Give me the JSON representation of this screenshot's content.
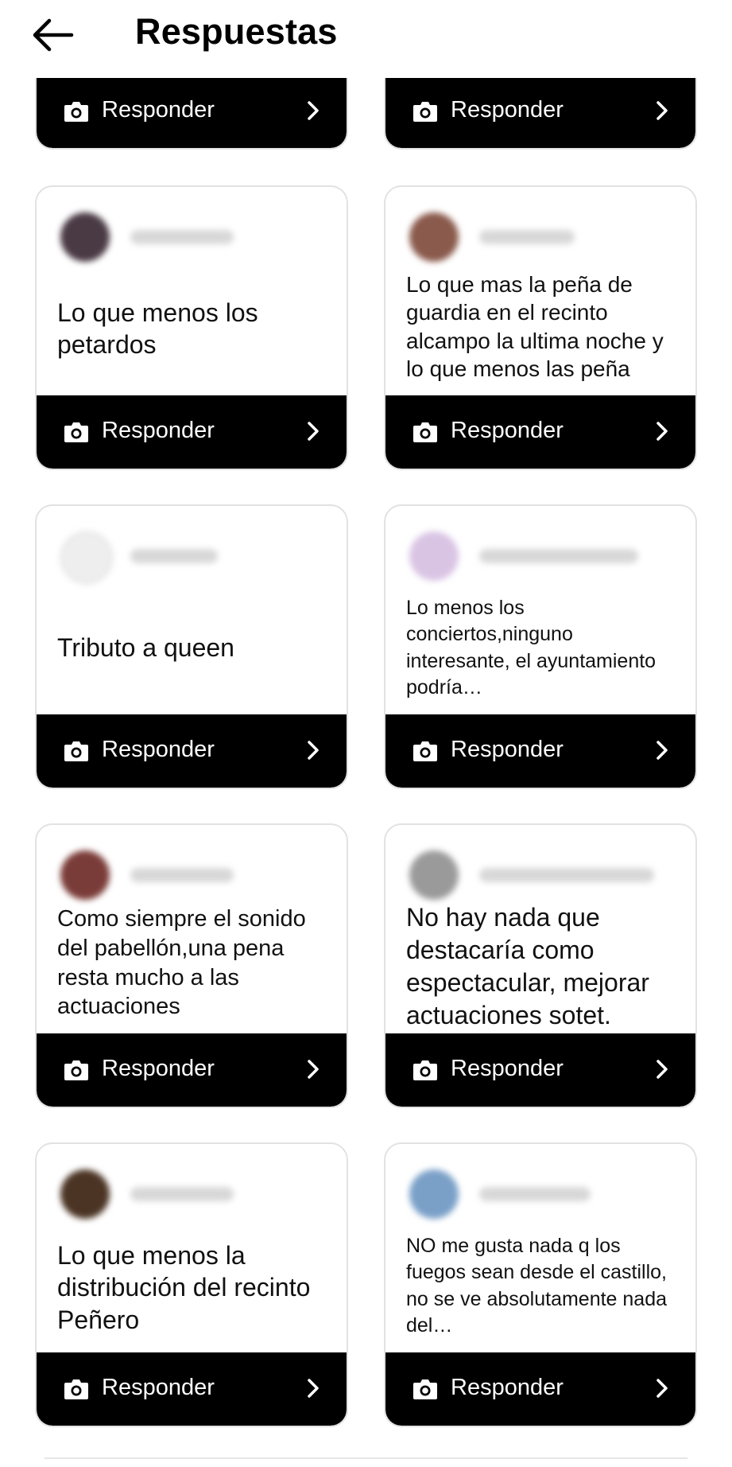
{
  "header": {
    "title": "Respuestas"
  },
  "reply_label": "Responder",
  "cards": [
    {
      "text": "",
      "avatar_color": "#000000"
    },
    {
      "text": "",
      "avatar_color": "#000000"
    },
    {
      "text": "Lo que menos los petardos",
      "avatar_color": "#4a3a44"
    },
    {
      "text": "Lo que mas la peña de guardia en el recinto alcampo la ultima noche y lo que menos las peña",
      "avatar_color": "#8a5a4c"
    },
    {
      "text": "Tributo a queen",
      "avatar_color": "#eeeeee"
    },
    {
      "text": "Lo menos los conciertos,ninguno interesante, el ayuntamiento podría…",
      "avatar_color": "#d9c4e4"
    },
    {
      "text": "Como siempre el sonido del pabellón,una pena resta mucho a las actuaciones",
      "avatar_color": "#7a3c38"
    },
    {
      "text": "No hay nada que destacaría como espectacular, mejorar actuaciones sotet.",
      "avatar_color": "#9a9a9a"
    },
    {
      "text": "Lo que menos la distribución del recinto Peñero",
      "avatar_color": "#4b3424"
    },
    {
      "text": "NO me gusta nada q los fuegos sean desde el castillo, no se ve absolutamente nada del…",
      "avatar_color": "#7aa0c8"
    }
  ]
}
